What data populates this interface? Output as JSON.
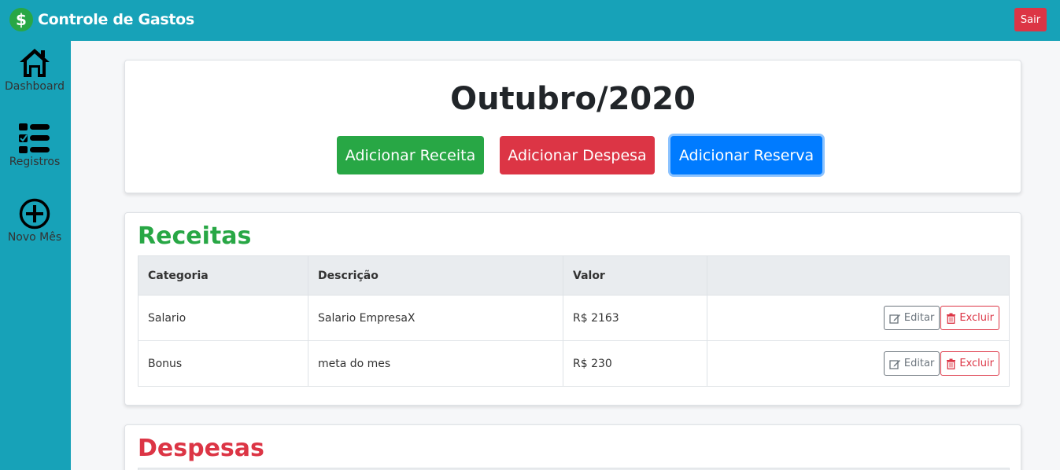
{
  "header": {
    "title": "Controle de Gastos",
    "logo_symbol": "$",
    "logout_label": "Sair"
  },
  "sidebar": {
    "items": [
      {
        "label": "Dashboard",
        "icon": "home-icon"
      },
      {
        "label": "Registros",
        "icon": "task-list-icon"
      },
      {
        "label": "Novo Mês",
        "icon": "plus-circle-icon"
      }
    ]
  },
  "month": {
    "title": "Outubro/2020",
    "add_income_label": "Adicionar Receita",
    "add_expense_label": "Adicionar Despesa",
    "add_reserve_label": "Adicionar Reserva"
  },
  "receitas": {
    "title": "Receitas",
    "columns": [
      "Categoria",
      "Descrição",
      "Valor",
      ""
    ],
    "rows": [
      {
        "categoria": "Salario",
        "descricao": "Salario EmpresaX",
        "valor": "R$ 2163",
        "edit_label": "Editar",
        "delete_label": "Excluir"
      },
      {
        "categoria": "Bonus",
        "descricao": "meta do mes",
        "valor": "R$ 230",
        "edit_label": "Editar",
        "delete_label": "Excluir"
      }
    ]
  },
  "despesas": {
    "title": "Despesas"
  },
  "colors": {
    "primary": "#17a2b8",
    "success": "#28a745",
    "danger": "#dc3545",
    "blue": "#007bff"
  }
}
